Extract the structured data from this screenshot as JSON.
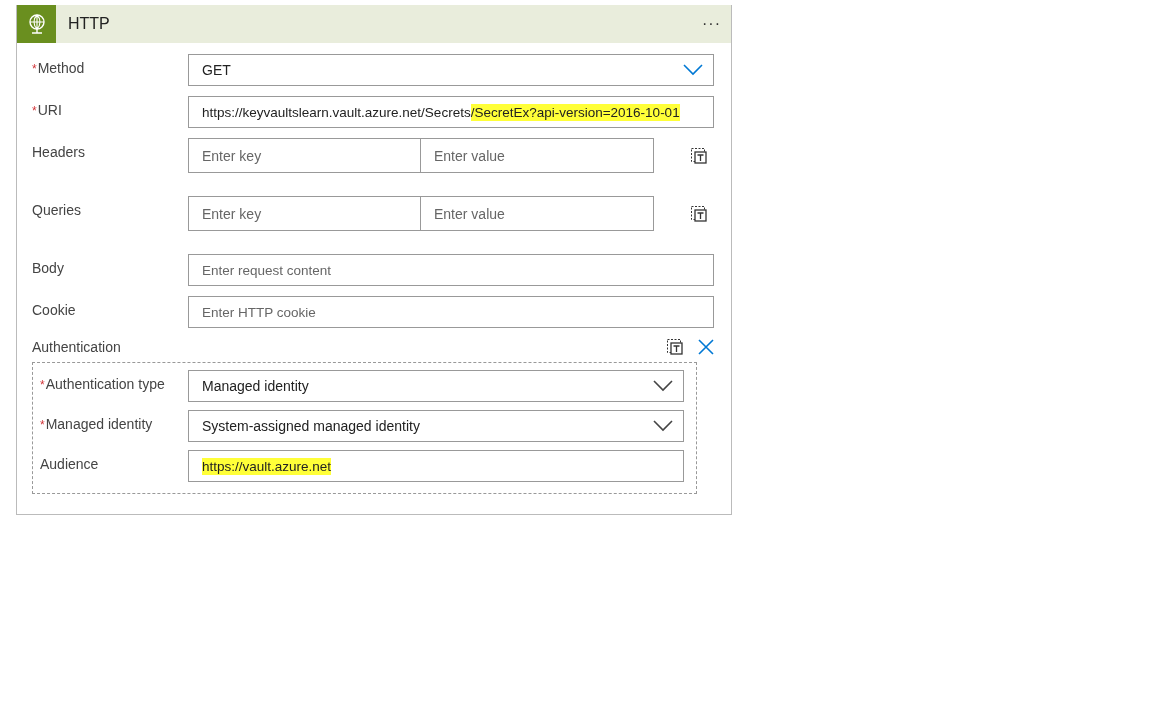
{
  "card": {
    "title": "HTTP",
    "menu": "···"
  },
  "required_marker": "*",
  "fields": [
    {
      "kind": "dropdown",
      "label": "Method",
      "required": true,
      "value": "GET"
    },
    {
      "kind": "text",
      "label": "URI",
      "required": true,
      "segments": [
        {
          "text": "https://keyvaultslearn.vault.azure.net/Secrets",
          "highlighted": false
        },
        {
          "text": "/SecretEx?api-version=2016-10-01",
          "highlighted": true
        }
      ]
    },
    {
      "kind": "keyvalue",
      "label": "Headers",
      "required": false,
      "key_placeholder": "Enter key",
      "value_placeholder": "Enter value"
    },
    {
      "kind": "keyvalue",
      "label": "Queries",
      "required": false,
      "key_placeholder": "Enter key",
      "value_placeholder": "Enter value"
    },
    {
      "kind": "text",
      "label": "Body",
      "required": false,
      "placeholder": "Enter request content"
    },
    {
      "kind": "text",
      "label": "Cookie",
      "required": false,
      "placeholder": "Enter HTTP cookie"
    }
  ],
  "authentication": {
    "label": "Authentication",
    "fields": [
      {
        "kind": "dropdown",
        "label": "Authentication type",
        "required": true,
        "value": "Managed identity"
      },
      {
        "kind": "dropdown",
        "label": "Managed identity",
        "required": true,
        "value": "System-assigned managed identity"
      },
      {
        "kind": "text",
        "label": "Audience",
        "required": false,
        "segments": [
          {
            "text": "https://vault.azure.net",
            "highlighted": true
          }
        ]
      }
    ]
  }
}
